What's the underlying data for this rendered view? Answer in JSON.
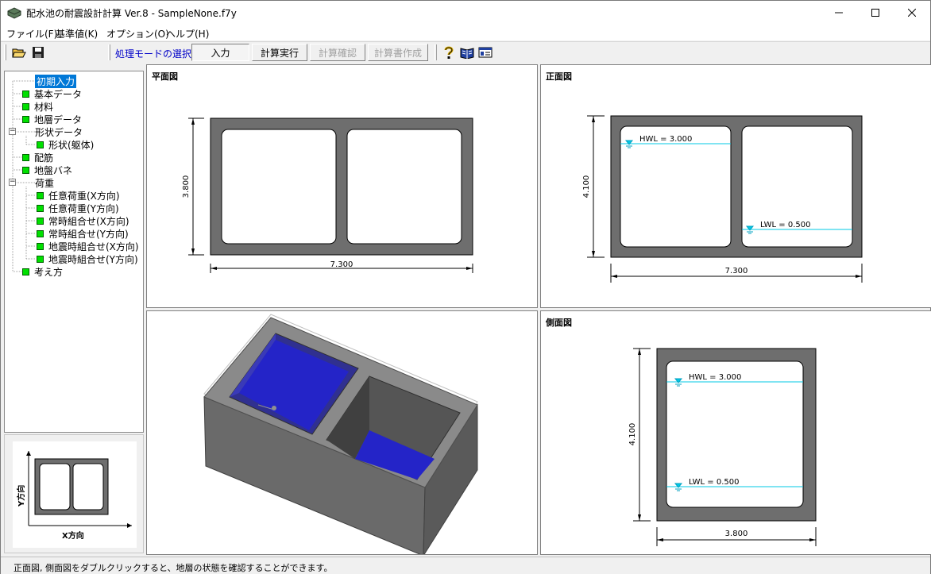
{
  "window": {
    "title": "配水池の耐震設計計算 Ver.8 - SampleNone.f7y"
  },
  "menu": {
    "file": "ファイル(F)",
    "standard": "基準値(K)",
    "options": "オプション(O)",
    "help": "ヘルプ(H)"
  },
  "toolbar": {
    "mode_label": "処理モードの選択",
    "input": "入力",
    "run": "計算実行",
    "confirm": "計算確認",
    "report": "計算書作成"
  },
  "tree": {
    "initial": "初期入力",
    "basic": "基本データ",
    "material": "材料",
    "strata": "地層データ",
    "shape_data": "形状データ",
    "shape_body": "形状(躯体)",
    "rebar": "配筋",
    "ground_spring": "地盤バネ",
    "load": "荷重",
    "load_x": "任意荷重(X方向)",
    "load_y": "任意荷重(Y方向)",
    "normal_x": "常時組合せ(X方向)",
    "normal_y": "常時組合せ(Y方向)",
    "seismic_x": "地震時組合せ(X方向)",
    "seismic_y": "地震時組合せ(Y方向)",
    "approach": "考え方"
  },
  "mini": {
    "x_label": "X方向",
    "y_label": "Y方向"
  },
  "plan_view": {
    "title": "平面図",
    "width": "7.300",
    "depth": "3.800"
  },
  "front_view": {
    "title": "正面図",
    "width": "7.300",
    "height": "4.100",
    "hwl": "HWL = 3.000",
    "lwl": "LWL = 0.500"
  },
  "side_view": {
    "title": "側面図",
    "width": "3.800",
    "height": "4.100",
    "hwl": "HWL = 3.000",
    "lwl": "LWL = 0.500"
  },
  "status": {
    "message": "正面図, 側面図をダブルクリックすると、地層の状態を確認することができます。"
  },
  "colors": {
    "wall": "#6e6e6e",
    "water_line": "#00c8e6",
    "water_fill": "#2020c8",
    "tree_square": "#00e000",
    "mode_label": "#0000c8"
  }
}
